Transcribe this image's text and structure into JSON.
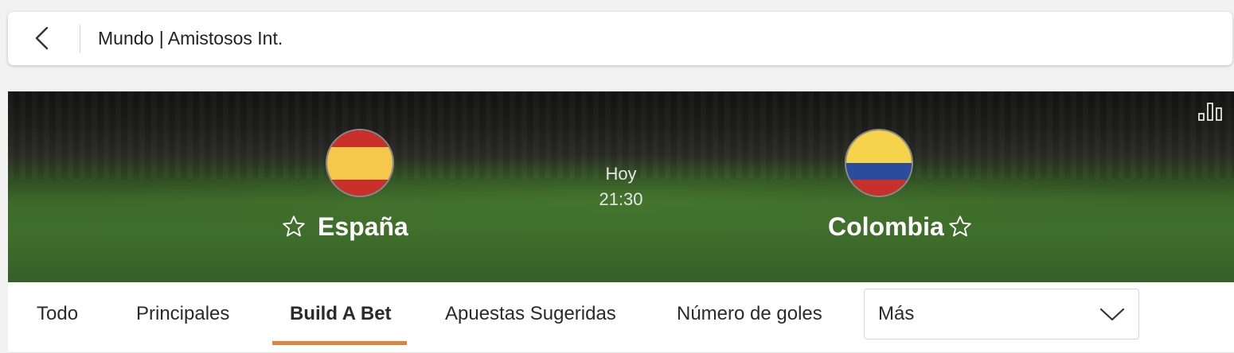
{
  "header": {
    "breadcrumb": "Mundo | Amistosos Int.",
    "back_icon": "chevron-left-icon"
  },
  "match": {
    "home": {
      "name": "España",
      "flag": "spain-flag",
      "colors": [
        "#c9302c",
        "#f5c84b",
        "#c9302c"
      ]
    },
    "away": {
      "name": "Colombia",
      "flag": "colombia-flag",
      "colors": [
        "#f5d44b",
        "#2a4c9a",
        "#c9302c"
      ]
    },
    "day": "Hoy",
    "time": "21:30",
    "stats_icon": "bar-chart-icon",
    "favorite_icon": "star-outline-icon"
  },
  "tabs": [
    {
      "label": "Todo",
      "active": false
    },
    {
      "label": "Principales",
      "active": false
    },
    {
      "label": "Build A Bet",
      "active": true
    },
    {
      "label": "Apuestas Sugeridas",
      "active": false
    },
    {
      "label": "Número de goles",
      "active": false
    }
  ],
  "more_select": {
    "label": "Más",
    "icon": "chevron-down-icon"
  },
  "colors": {
    "accent": "#e3823a",
    "background": "#f2f2f2"
  }
}
